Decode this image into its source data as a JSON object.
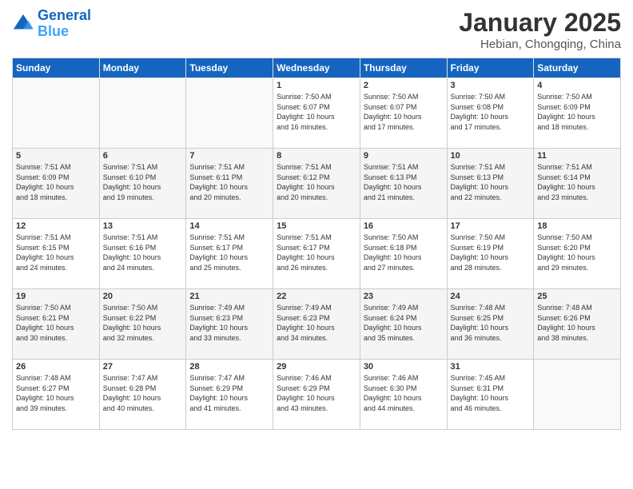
{
  "header": {
    "logo_line1": "General",
    "logo_line2": "Blue",
    "month": "January 2025",
    "location": "Hebian, Chongqing, China"
  },
  "weekdays": [
    "Sunday",
    "Monday",
    "Tuesday",
    "Wednesday",
    "Thursday",
    "Friday",
    "Saturday"
  ],
  "weeks": [
    [
      {
        "day": "",
        "info": ""
      },
      {
        "day": "",
        "info": ""
      },
      {
        "day": "",
        "info": ""
      },
      {
        "day": "1",
        "info": "Sunrise: 7:50 AM\nSunset: 6:07 PM\nDaylight: 10 hours\nand 16 minutes."
      },
      {
        "day": "2",
        "info": "Sunrise: 7:50 AM\nSunset: 6:07 PM\nDaylight: 10 hours\nand 17 minutes."
      },
      {
        "day": "3",
        "info": "Sunrise: 7:50 AM\nSunset: 6:08 PM\nDaylight: 10 hours\nand 17 minutes."
      },
      {
        "day": "4",
        "info": "Sunrise: 7:50 AM\nSunset: 6:09 PM\nDaylight: 10 hours\nand 18 minutes."
      }
    ],
    [
      {
        "day": "5",
        "info": "Sunrise: 7:51 AM\nSunset: 6:09 PM\nDaylight: 10 hours\nand 18 minutes."
      },
      {
        "day": "6",
        "info": "Sunrise: 7:51 AM\nSunset: 6:10 PM\nDaylight: 10 hours\nand 19 minutes."
      },
      {
        "day": "7",
        "info": "Sunrise: 7:51 AM\nSunset: 6:11 PM\nDaylight: 10 hours\nand 20 minutes."
      },
      {
        "day": "8",
        "info": "Sunrise: 7:51 AM\nSunset: 6:12 PM\nDaylight: 10 hours\nand 20 minutes."
      },
      {
        "day": "9",
        "info": "Sunrise: 7:51 AM\nSunset: 6:13 PM\nDaylight: 10 hours\nand 21 minutes."
      },
      {
        "day": "10",
        "info": "Sunrise: 7:51 AM\nSunset: 6:13 PM\nDaylight: 10 hours\nand 22 minutes."
      },
      {
        "day": "11",
        "info": "Sunrise: 7:51 AM\nSunset: 6:14 PM\nDaylight: 10 hours\nand 23 minutes."
      }
    ],
    [
      {
        "day": "12",
        "info": "Sunrise: 7:51 AM\nSunset: 6:15 PM\nDaylight: 10 hours\nand 24 minutes."
      },
      {
        "day": "13",
        "info": "Sunrise: 7:51 AM\nSunset: 6:16 PM\nDaylight: 10 hours\nand 24 minutes."
      },
      {
        "day": "14",
        "info": "Sunrise: 7:51 AM\nSunset: 6:17 PM\nDaylight: 10 hours\nand 25 minutes."
      },
      {
        "day": "15",
        "info": "Sunrise: 7:51 AM\nSunset: 6:17 PM\nDaylight: 10 hours\nand 26 minutes."
      },
      {
        "day": "16",
        "info": "Sunrise: 7:50 AM\nSunset: 6:18 PM\nDaylight: 10 hours\nand 27 minutes."
      },
      {
        "day": "17",
        "info": "Sunrise: 7:50 AM\nSunset: 6:19 PM\nDaylight: 10 hours\nand 28 minutes."
      },
      {
        "day": "18",
        "info": "Sunrise: 7:50 AM\nSunset: 6:20 PM\nDaylight: 10 hours\nand 29 minutes."
      }
    ],
    [
      {
        "day": "19",
        "info": "Sunrise: 7:50 AM\nSunset: 6:21 PM\nDaylight: 10 hours\nand 30 minutes."
      },
      {
        "day": "20",
        "info": "Sunrise: 7:50 AM\nSunset: 6:22 PM\nDaylight: 10 hours\nand 32 minutes."
      },
      {
        "day": "21",
        "info": "Sunrise: 7:49 AM\nSunset: 6:23 PM\nDaylight: 10 hours\nand 33 minutes."
      },
      {
        "day": "22",
        "info": "Sunrise: 7:49 AM\nSunset: 6:23 PM\nDaylight: 10 hours\nand 34 minutes."
      },
      {
        "day": "23",
        "info": "Sunrise: 7:49 AM\nSunset: 6:24 PM\nDaylight: 10 hours\nand 35 minutes."
      },
      {
        "day": "24",
        "info": "Sunrise: 7:48 AM\nSunset: 6:25 PM\nDaylight: 10 hours\nand 36 minutes."
      },
      {
        "day": "25",
        "info": "Sunrise: 7:48 AM\nSunset: 6:26 PM\nDaylight: 10 hours\nand 38 minutes."
      }
    ],
    [
      {
        "day": "26",
        "info": "Sunrise: 7:48 AM\nSunset: 6:27 PM\nDaylight: 10 hours\nand 39 minutes."
      },
      {
        "day": "27",
        "info": "Sunrise: 7:47 AM\nSunset: 6:28 PM\nDaylight: 10 hours\nand 40 minutes."
      },
      {
        "day": "28",
        "info": "Sunrise: 7:47 AM\nSunset: 6:29 PM\nDaylight: 10 hours\nand 41 minutes."
      },
      {
        "day": "29",
        "info": "Sunrise: 7:46 AM\nSunset: 6:29 PM\nDaylight: 10 hours\nand 43 minutes."
      },
      {
        "day": "30",
        "info": "Sunrise: 7:46 AM\nSunset: 6:30 PM\nDaylight: 10 hours\nand 44 minutes."
      },
      {
        "day": "31",
        "info": "Sunrise: 7:45 AM\nSunset: 6:31 PM\nDaylight: 10 hours\nand 46 minutes."
      },
      {
        "day": "",
        "info": ""
      }
    ]
  ]
}
